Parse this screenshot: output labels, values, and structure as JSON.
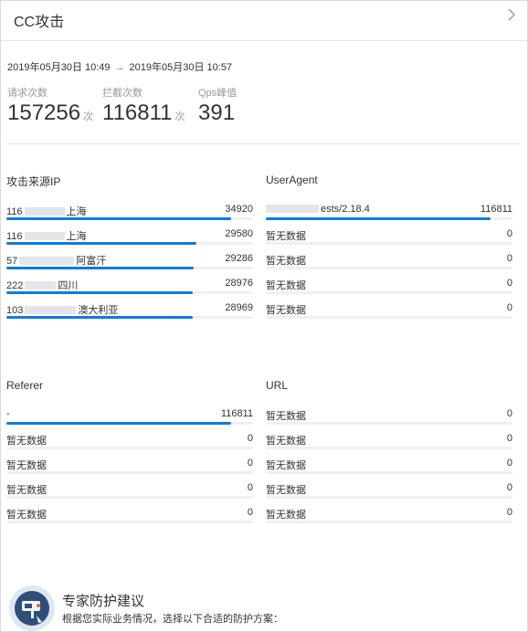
{
  "dialog": {
    "title": "CC攻击",
    "close_icon": "close-icon"
  },
  "time_range": {
    "start": "2019年05月30日 10:49",
    "arrow": "→",
    "end": "2019年05月30日 10:57"
  },
  "stats": [
    {
      "label": "请求次数",
      "value": "157256",
      "unit": "次"
    },
    {
      "label": "拦截次数",
      "value": "116811",
      "unit": "次"
    },
    {
      "label": "Qps峰值",
      "value": "391",
      "unit": ""
    }
  ],
  "colors": {
    "bar": "#0f7be0",
    "track": "#f0f0f0"
  },
  "sections": {
    "source_ip": {
      "title": "攻击来源IP",
      "rows": [
        {
          "prefix": "116",
          "suffix": "上海",
          "value": "34920",
          "fill": 0.91
        },
        {
          "prefix": "116",
          "suffix": "上海",
          "value": "29580",
          "fill": 0.77
        },
        {
          "prefix": "57",
          "suffix": "阿富汗",
          "value": "29286",
          "fill": 0.76
        },
        {
          "prefix": "222",
          "suffix": "四川",
          "value": "28976",
          "fill": 0.755
        },
        {
          "prefix": "103",
          "suffix": "澳大利亚",
          "value": "28969",
          "fill": 0.755
        }
      ]
    },
    "user_agent": {
      "title": "UserAgent",
      "rows": [
        {
          "prefix": "",
          "suffix": "ests/2.18.4",
          "value": "116811",
          "fill": 0.91
        },
        {
          "prefix": "暂无数据",
          "suffix": "",
          "value": "0",
          "fill": 0
        },
        {
          "prefix": "暂无数据",
          "suffix": "",
          "value": "0",
          "fill": 0
        },
        {
          "prefix": "暂无数据",
          "suffix": "",
          "value": "0",
          "fill": 0
        },
        {
          "prefix": "暂无数据",
          "suffix": "",
          "value": "0",
          "fill": 0
        }
      ]
    },
    "referer": {
      "title": "Referer",
      "rows": [
        {
          "prefix": "-",
          "suffix": "",
          "value": "116811",
          "fill": 0.91
        },
        {
          "prefix": "暂无数据",
          "suffix": "",
          "value": "0",
          "fill": 0
        },
        {
          "prefix": "暂无数据",
          "suffix": "",
          "value": "0",
          "fill": 0
        },
        {
          "prefix": "暂无数据",
          "suffix": "",
          "value": "0",
          "fill": 0
        },
        {
          "prefix": "暂无数据",
          "suffix": "",
          "value": "0",
          "fill": 0
        }
      ]
    },
    "url": {
      "title": "URL",
      "rows": [
        {
          "prefix": "暂无数据",
          "suffix": "",
          "value": "0",
          "fill": 0
        },
        {
          "prefix": "暂无数据",
          "suffix": "",
          "value": "0",
          "fill": 0
        },
        {
          "prefix": "暂无数据",
          "suffix": "",
          "value": "0",
          "fill": 0
        },
        {
          "prefix": "暂无数据",
          "suffix": "",
          "value": "0",
          "fill": 0
        },
        {
          "prefix": "暂无数据",
          "suffix": "",
          "value": "0",
          "fill": 0
        }
      ]
    }
  },
  "expert": {
    "title": "专家防护建议",
    "description": "根据您实际业务情况，选择以下合适的防护方案：",
    "avatar_icon": "expert-avatar-icon"
  }
}
